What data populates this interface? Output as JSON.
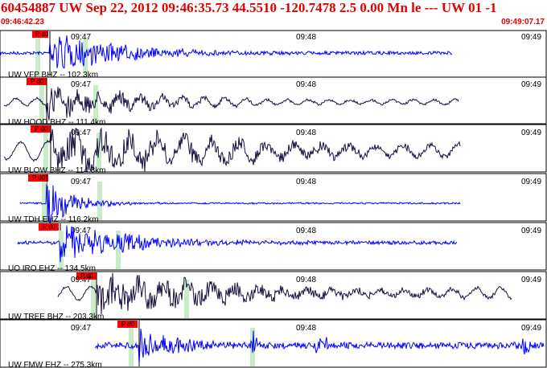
{
  "header": {
    "title": "60454887 UW Sep 22, 2012 09:46:35.73    44.5510 -120.7478  2.5 0.00 Mn le --- UW 01   -1",
    "start_time": "09:46:42.23",
    "end_time": "09:49:07.17"
  },
  "time_ticks": [
    "09:47",
    "09:48",
    "09:49"
  ],
  "pick_label": "P d0",
  "colors": {
    "header_text": "#e00000",
    "trace_blue": "#0000ff",
    "trace_dark": "#1a1040",
    "pick_flag": "#ff0000",
    "window_marker": "#c8ecc8"
  },
  "traces": [
    {
      "label": "UW VFP BHZ -- 102.3km",
      "color": "blue"
    },
    {
      "label": "UW HOOD BHZ -- 111.4km",
      "color": "dark"
    },
    {
      "label": "UW BLOW BHZ -- 114.8km",
      "color": "dark"
    },
    {
      "label": "UW TDH EHZ -- 116.2km",
      "color": "blue"
    },
    {
      "label": "UO IRO EHZ -- 134.5km",
      "color": "blue"
    },
    {
      "label": "UW TREE BHZ -- 203.3km",
      "color": "dark"
    },
    {
      "label": "UW FMW EHZ -- 275.3km",
      "color": "blue"
    }
  ]
}
